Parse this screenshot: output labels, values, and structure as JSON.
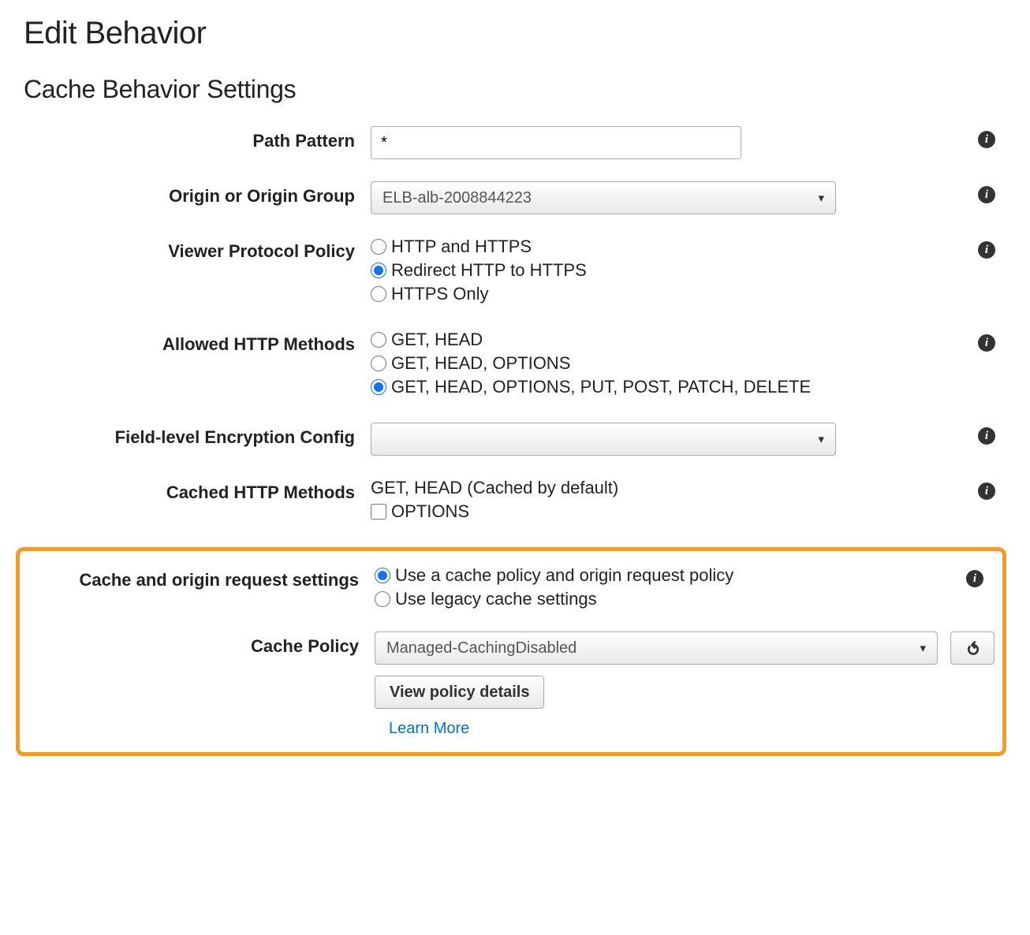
{
  "page_title": "Edit Behavior",
  "section_title": "Cache Behavior Settings",
  "fields": {
    "path_pattern": {
      "label": "Path Pattern",
      "value": "*"
    },
    "origin": {
      "label": "Origin or Origin Group",
      "selected": "ELB-alb-2008844223"
    },
    "viewer_protocol": {
      "label": "Viewer Protocol Policy",
      "opt1": "HTTP and HTTPS",
      "opt2": "Redirect HTTP to HTTPS",
      "opt3": "HTTPS Only"
    },
    "allowed_methods": {
      "label": "Allowed HTTP Methods",
      "opt1": "GET, HEAD",
      "opt2": "GET, HEAD, OPTIONS",
      "opt3": "GET, HEAD, OPTIONS, PUT, POST, PATCH, DELETE"
    },
    "field_encryption": {
      "label": "Field-level Encryption Config",
      "selected": ""
    },
    "cached_methods": {
      "label": "Cached HTTP Methods",
      "note": "GET, HEAD (Cached by default)",
      "opt1": "OPTIONS"
    },
    "cache_origin_settings": {
      "label": "Cache and origin request settings",
      "opt1": "Use a cache policy and origin request policy",
      "opt2": "Use legacy cache settings"
    },
    "cache_policy": {
      "label": "Cache Policy",
      "selected": "Managed-CachingDisabled",
      "view_button": "View policy details",
      "learn_more": "Learn More"
    }
  }
}
